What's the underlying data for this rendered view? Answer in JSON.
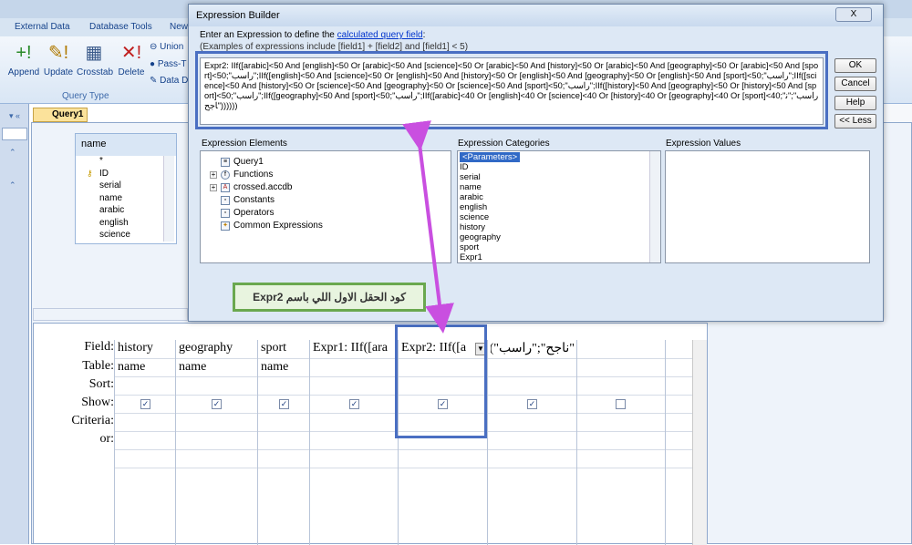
{
  "ribbon": {
    "tabs": [
      "External Data",
      "Database Tools",
      "New"
    ],
    "buttons": [
      "Append",
      "Update",
      "Crosstab",
      "Delete"
    ],
    "small_buttons": [
      "Union",
      "Pass-T",
      "Data D"
    ],
    "group_label": "Query Type"
  },
  "query_tab": "Query1",
  "table": {
    "name": "name",
    "fields": [
      "*",
      "ID",
      "serial",
      "name",
      "arabic",
      "english",
      "science"
    ]
  },
  "grid": {
    "row_labels": [
      "Field:",
      "Table:",
      "Sort:",
      "Show:",
      "Criteria:",
      "or:"
    ],
    "columns": [
      {
        "field": "history",
        "table": "name",
        "show": true
      },
      {
        "field": "geography",
        "table": "name",
        "show": true
      },
      {
        "field": "sport",
        "table": "name",
        "show": true
      },
      {
        "field": "Expr1: IIf([ara",
        "table": "",
        "show": true
      },
      {
        "field": "Expr2: IIf([a",
        "table": "",
        "show": true
      },
      {
        "field": "\"ناجح\";\"راسب\"))",
        "table": "",
        "show": true
      },
      {
        "field": "",
        "table": "",
        "show": false
      }
    ]
  },
  "dialog": {
    "title": "Expression Builder",
    "close_label": "X",
    "intro_text": "Enter an Expression to define the",
    "intro_link": "calculated query field",
    "intro_end": ":",
    "examples": "(Examples of expressions include [field1] + [field2] and [field1] < 5)",
    "expression": "Expr2: IIf([arabic]<50 And [english]<50 Or [arabic]<50 And [science]<50 Or [arabic]<50 And [history]<50 Or [arabic]<50 And [geography]<50 Or [arabic]<50 And [sport]<50;\"راسب\";IIf([english]<50 And [science]<50 Or [english]<50 And [history]<50 Or [english]<50 And [geography]<50 Or [english]<50 And [sport]<50;\"راسب\";IIf([science]<50 And [history]<50 Or [science]<50 And [geography]<50 Or [science]<50 And [sport]<50;\"راسب\";IIf([history]<50 And [geography]<50 Or [history]<50 And [sport]<50;\"راسب\";IIf([geography]<50 And [sport]<50;\"راسب\";IIf([arabic]<40 Or [english]<40 Or [science]<40 Or [history]<40 Or [geography]<40 Or [sport]<40;\"راسب\";\"ناجح\"))))))",
    "buttons": {
      "ok": "OK",
      "cancel": "Cancel",
      "help": "Help",
      "less": "<< Less"
    },
    "elements_label": "Expression Elements",
    "categories_label": "Expression Categories",
    "values_label": "Expression Values",
    "elements": [
      "Query1",
      "Functions",
      "crossed.accdb",
      "Constants",
      "Operators",
      "Common Expressions"
    ],
    "categories": [
      "<Parameters>",
      "ID",
      "serial",
      "name",
      "arabic",
      "english",
      "science",
      "history",
      "geography",
      "sport",
      "Expr1"
    ]
  },
  "callout_text": "كود الحقل الاول اللي باسم Expr2",
  "colors": {
    "highlight_blue": "#4a6fc2",
    "arrow": "#c94fe0",
    "callout_border": "#6aa84f"
  }
}
